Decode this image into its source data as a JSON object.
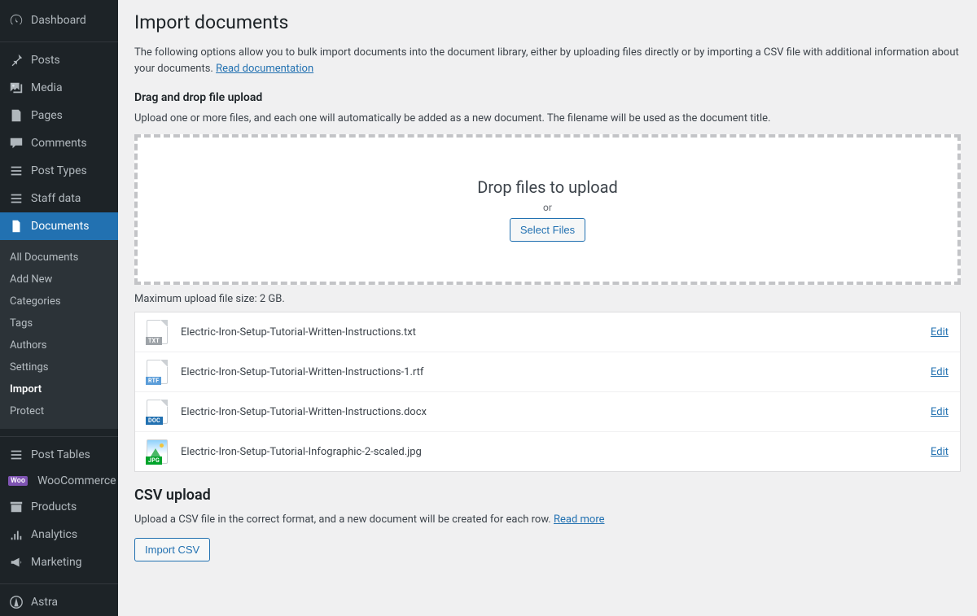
{
  "sidebar": {
    "items": [
      {
        "name": "dashboard",
        "label": "Dashboard",
        "icon": "dashboard"
      },
      {
        "name": "posts",
        "label": "Posts",
        "icon": "pin"
      },
      {
        "name": "media",
        "label": "Media",
        "icon": "media"
      },
      {
        "name": "pages",
        "label": "Pages",
        "icon": "page"
      },
      {
        "name": "comments",
        "label": "Comments",
        "icon": "comment"
      },
      {
        "name": "post-types",
        "label": "Post Types",
        "icon": "list"
      },
      {
        "name": "staff-data",
        "label": "Staff data",
        "icon": "list"
      },
      {
        "name": "documents",
        "label": "Documents",
        "icon": "doc",
        "current": true
      },
      {
        "name": "post-tables",
        "label": "Post Tables",
        "icon": "list"
      },
      {
        "name": "woocommerce",
        "label": "WooCommerce",
        "icon": "woo"
      },
      {
        "name": "products",
        "label": "Products",
        "icon": "archive"
      },
      {
        "name": "analytics",
        "label": "Analytics",
        "icon": "chart"
      },
      {
        "name": "marketing",
        "label": "Marketing",
        "icon": "megaphone"
      },
      {
        "name": "astra",
        "label": "Astra",
        "icon": "astra"
      }
    ],
    "submenu": [
      {
        "label": "All Documents"
      },
      {
        "label": "Add New"
      },
      {
        "label": "Categories"
      },
      {
        "label": "Tags"
      },
      {
        "label": "Authors"
      },
      {
        "label": "Settings"
      },
      {
        "label": "Import",
        "current": true
      },
      {
        "label": "Protect"
      }
    ]
  },
  "main": {
    "title": "Import documents",
    "intro_prefix": "The following options allow you to bulk import documents into the document library, either by uploading files directly or by importing a CSV file with additional information about your documents. ",
    "intro_link": "Read documentation",
    "dragdrop": {
      "heading": "Drag and drop file upload",
      "help": "Upload one or more files, and each one will automatically be added as a new document. The filename will be used as the document title.",
      "dz_title": "Drop files to upload",
      "dz_or": "or",
      "select_btn": "Select Files",
      "max_upload": "Maximum upload file size: 2 GB."
    },
    "files": [
      {
        "name": "Electric-Iron-Setup-Tutorial-Written-Instructions.txt",
        "ext": "TXT",
        "extClass": "ext-txt"
      },
      {
        "name": "Electric-Iron-Setup-Tutorial-Written-Instructions-1.rtf",
        "ext": "RTF",
        "extClass": "ext-rtf"
      },
      {
        "name": "Electric-Iron-Setup-Tutorial-Written-Instructions.docx",
        "ext": "DOC",
        "extClass": "ext-doc"
      },
      {
        "name": "Electric-Iron-Setup-Tutorial-Infographic-2-scaled.jpg",
        "ext": "JPG",
        "extClass": "ext-jpg",
        "img": true
      }
    ],
    "edit_label": "Edit",
    "csv": {
      "heading": "CSV upload",
      "desc_prefix": "Upload a CSV file in the correct format, and a new document will be created for each row. ",
      "desc_link": "Read more",
      "button": "Import CSV"
    }
  }
}
